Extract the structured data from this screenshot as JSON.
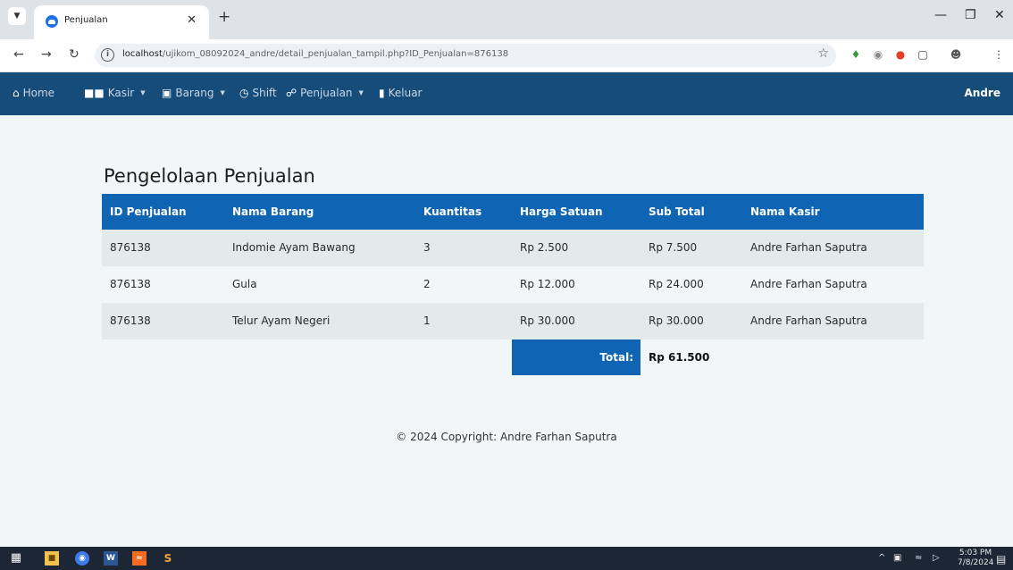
{
  "browser": {
    "tab_title": "Penjualan",
    "url_host": "localhost",
    "url_path": "/ujikom_08092024_andre/detail_penjualan_tampil.php?ID_Penjualan=876138"
  },
  "navbar": {
    "items": [
      {
        "label": "Home",
        "icon": "home-icon"
      },
      {
        "label": "Kasir",
        "icon": "users-icon",
        "dropdown": true
      },
      {
        "label": "Barang",
        "icon": "box-icon",
        "dropdown": true
      },
      {
        "label": "Shift",
        "icon": "clock-icon"
      },
      {
        "label": "Penjualan",
        "icon": "cart-icon",
        "dropdown": true
      },
      {
        "label": "Keluar",
        "icon": "exit-icon"
      }
    ],
    "user": "Andre"
  },
  "main": {
    "title": "Pengelolaan Penjualan",
    "columns": [
      "ID Penjualan",
      "Nama Barang",
      "Kuantitas",
      "Harga Satuan",
      "Sub Total",
      "Nama Kasir"
    ],
    "rows": [
      [
        "876138",
        "Indomie Ayam Bawang",
        "3",
        "Rp 2.500",
        "Rp 7.500",
        "Andre Farhan Saputra"
      ],
      [
        "876138",
        "Gula",
        "2",
        "Rp 12.000",
        "Rp 24.000",
        "Andre Farhan Saputra"
      ],
      [
        "876138",
        "Telur Ayam Negeri",
        "1",
        "Rp 30.000",
        "Rp 30.000",
        "Andre Farhan Saputra"
      ]
    ],
    "total_label": "Total:",
    "total_value": "Rp 61.500"
  },
  "footer": {
    "text": "© 2024 Copyright: Andre Farhan Saputra"
  },
  "taskbar": {
    "time": "5:03 PM",
    "date": "7/8/2024"
  },
  "colors": {
    "navbar": "#164c7a",
    "table_header": "#0f65b4",
    "page_bg": "#f1f7f7"
  }
}
